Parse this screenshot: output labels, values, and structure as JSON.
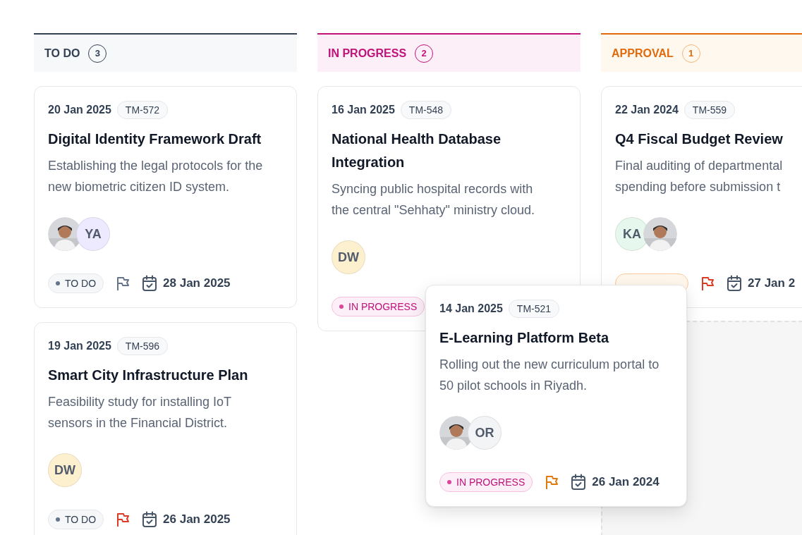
{
  "columns": [
    {
      "kind": "todo",
      "title": "TO DO",
      "count": "3",
      "cards": [
        {
          "date": "20 Jan 2025",
          "id": "TM-572",
          "title": "Digital Identity Framework Draft",
          "description": "Establishing the legal protocols for the new biometric citizen ID system.",
          "avatars": [
            {
              "kind": "picture"
            },
            {
              "kind": "initials",
              "text": "YA",
              "color": "#ede9fe"
            }
          ],
          "status": {
            "kind": "todo",
            "label": "TO DO"
          },
          "flag": {
            "color": "#64748b"
          },
          "due": "28 Jan 2025"
        },
        {
          "date": "19 Jan 2025",
          "id": "TM-596",
          "title": "Smart City Infrastructure Plan",
          "description": "Feasibility study for installing IoT sensors in the Financial District.",
          "avatars": [
            {
              "kind": "initials",
              "text": "DW",
              "color": "#fdf0cf"
            }
          ],
          "status": {
            "kind": "todo",
            "label": "TO DO"
          },
          "flag": {
            "color": "#dc3b26"
          },
          "due": "26 Jan 2025"
        }
      ]
    },
    {
      "kind": "in_progress",
      "title": "IN PROGRESS",
      "count": "2",
      "cards": [
        {
          "date": "16 Jan 2025",
          "id": "TM-548",
          "title": "National Health Database Integration",
          "description": "Syncing public hospital records with the central \"Sehhaty\" ministry cloud.",
          "avatars": [
            {
              "kind": "initials",
              "text": "DW",
              "color": "#fdf0cf"
            }
          ],
          "status": {
            "kind": "in_progress",
            "label": "IN PROGRESS"
          }
        }
      ]
    },
    {
      "kind": "approval",
      "title": "APPROVAL",
      "count": "1",
      "drop_zone": true,
      "cards": [
        {
          "date": "22 Jan 2024",
          "id": "TM-559",
          "title": "Q4 Fiscal Budget Review",
          "description": "Final auditing of departmental spending before submission t",
          "avatars": [
            {
              "kind": "initials",
              "text": "KA",
              "color": "#e6f7ee"
            },
            {
              "kind": "picture"
            }
          ],
          "status": {
            "kind": "approval"
          },
          "flag": {
            "color": "#dc3b26"
          },
          "due": "27 Jan 2"
        }
      ]
    }
  ],
  "dragged_card": {
    "date": "14 Jan 2025",
    "id": "TM-521",
    "title": "E-Learning Platform Beta",
    "description": "Rolling out the new curriculum portal to 50 pilot schools in Riyadh.",
    "avatars": [
      {
        "kind": "picture"
      },
      {
        "kind": "initials",
        "text": "OR",
        "color": "#f3f4f6"
      }
    ],
    "status": {
      "kind": "in_progress",
      "label": "IN PROGRESS"
    },
    "flag": {
      "color": "#e07a0c"
    },
    "due": "26 Jan 2024"
  }
}
